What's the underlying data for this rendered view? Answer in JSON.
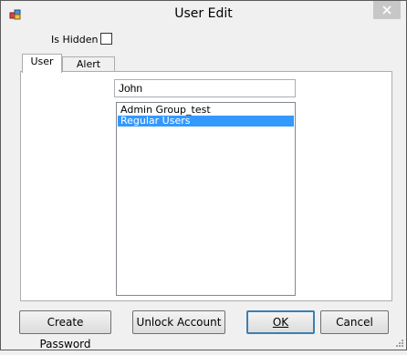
{
  "window": {
    "title": "User Edit",
    "accent": "#3399ff"
  },
  "form": {
    "is_hidden_label": "Is Hidden",
    "is_hidden_checked": false
  },
  "tabs": [
    {
      "label": "User",
      "active": true
    },
    {
      "label": "Alert Subs",
      "active": false
    }
  ],
  "user_tab": {
    "name_value": "John",
    "groups": [
      {
        "label": "Admin Group_test",
        "selected": false
      },
      {
        "label": "Regular Users",
        "selected": true
      }
    ]
  },
  "buttons": {
    "create_password": "Create Password",
    "unlock_account": "Unlock Account",
    "ok": "OK",
    "cancel": "Cancel"
  }
}
